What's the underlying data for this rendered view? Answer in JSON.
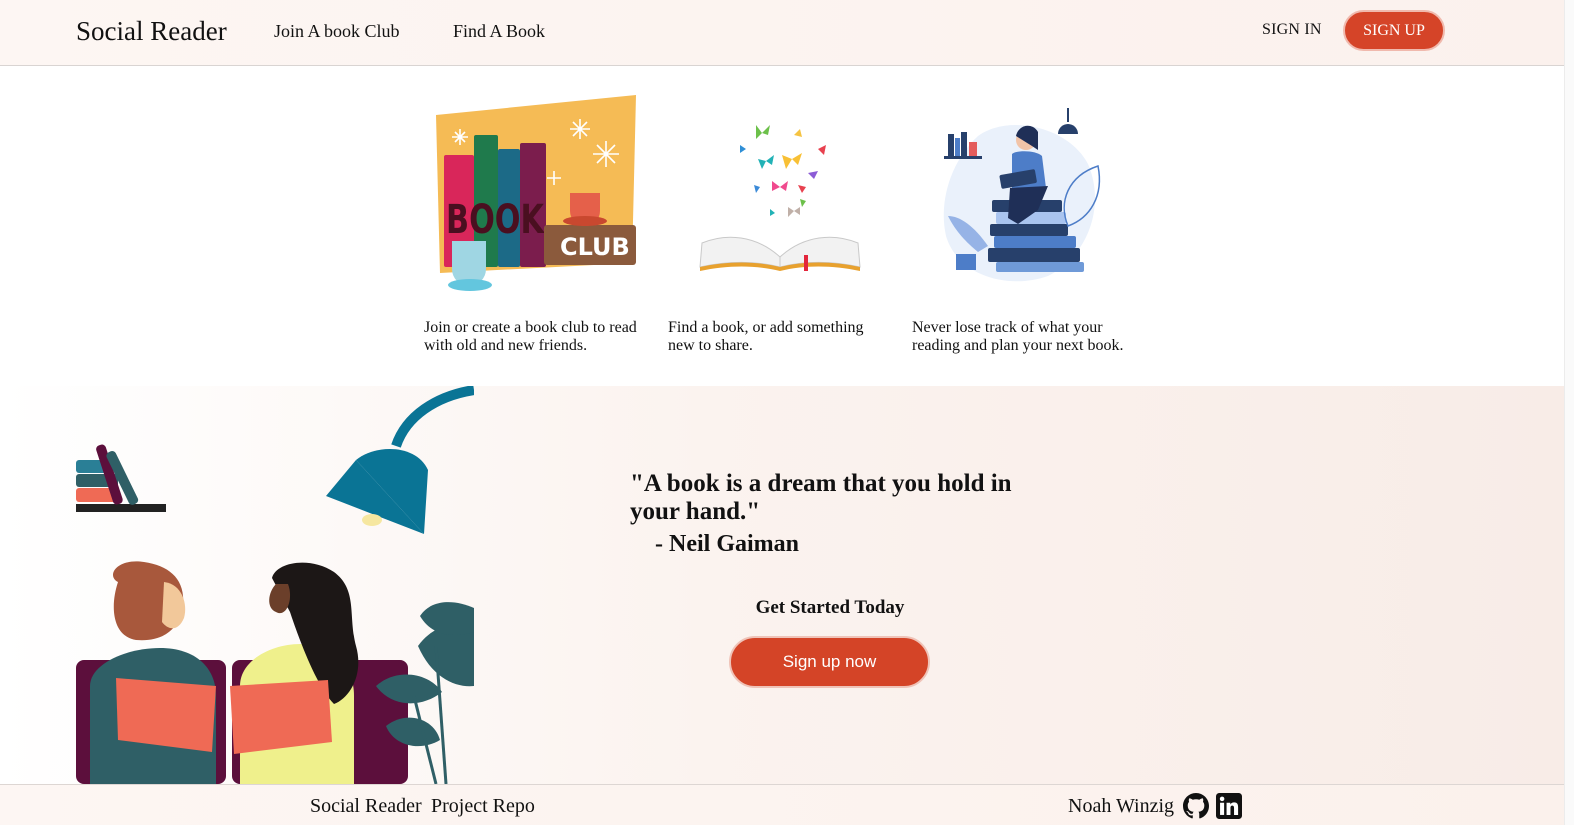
{
  "nav": {
    "brand": "Social Reader",
    "links": [
      "Join A book Club",
      "Find A Book"
    ],
    "sign_in": "SIGN IN",
    "sign_up": "SIGN UP"
  },
  "features": [
    {
      "icon": "book-club-illustration",
      "text": "Join or create a book club to read with old and new friends."
    },
    {
      "icon": "open-book-butterflies-illustration",
      "text": "Find a book, or add something new to share."
    },
    {
      "icon": "woman-reading-on-books-illustration",
      "text": "Never lose track of what your reading and plan your next book."
    }
  ],
  "book_club_art_label": "CLUB",
  "book_club_art_letters": "BOOK",
  "hero": {
    "quote": "\"A book is a dream that you hold in your hand.\"",
    "author": "- Neil Gaiman",
    "cta_heading": "Get Started Today",
    "cta_button": "Sign up now"
  },
  "footer": {
    "brand": "Social Reader",
    "repo": "Project Repo",
    "author": "Noah Winzig",
    "icons": [
      "github-icon",
      "linkedin-icon"
    ]
  },
  "colors": {
    "accent": "#d54428",
    "hero_bg": "#f8ece7",
    "lamp": "#0a7495",
    "couch": "#5c0f3c"
  }
}
